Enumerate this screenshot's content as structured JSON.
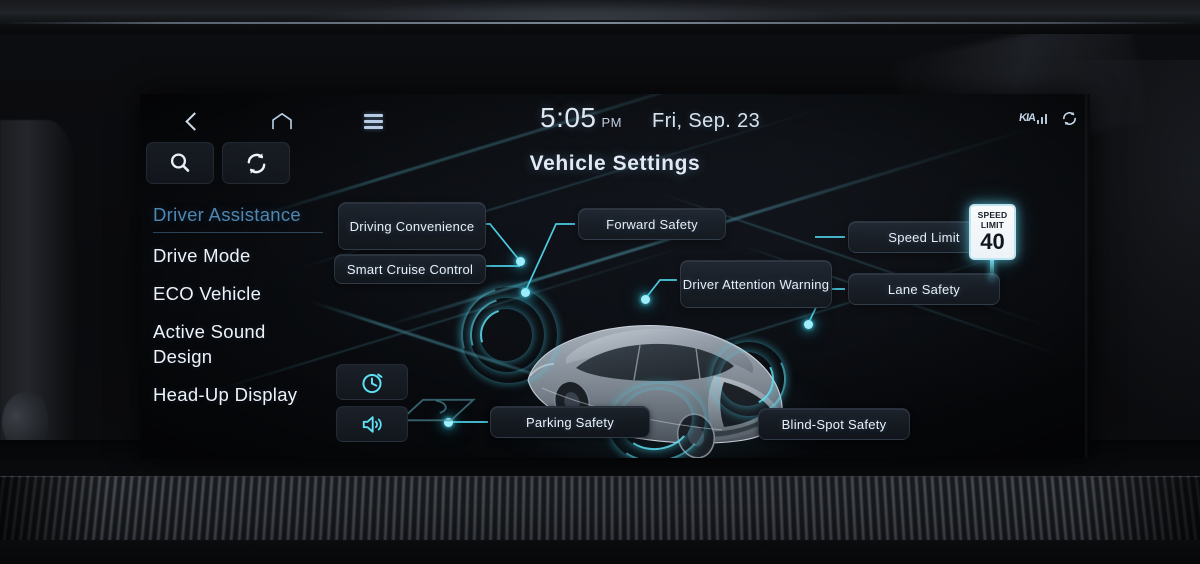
{
  "screen": {
    "title": "Vehicle Settings"
  },
  "topbar": {
    "back_icon": "chevron-left-icon",
    "home_icon": "home-icon",
    "menu_icon": "hamburger-menu-icon",
    "time": "5:05",
    "ampm": "PM",
    "date": "Fri, Sep. 23",
    "brand_mark": "KIA",
    "signal_icon": "signal-bars-icon",
    "sync_icon": "sync-icon"
  },
  "sidebar": {
    "search_icon": "search-icon",
    "refresh_icon": "refresh-sync-icon",
    "items": [
      {
        "label": "Driver Assistance",
        "active": true
      },
      {
        "label": "Drive Mode",
        "active": false
      },
      {
        "label": "ECO Vehicle",
        "active": false
      },
      {
        "label": "Active Sound Design",
        "active": false
      },
      {
        "label": "Head-Up Display",
        "active": false
      }
    ]
  },
  "diagram": {
    "features": [
      {
        "label": "Driving Convenience"
      },
      {
        "label": "Smart Cruise Control"
      },
      {
        "label": "Forward Safety"
      },
      {
        "label": "Driver Attention Warning"
      },
      {
        "label": "Speed Limit"
      },
      {
        "label": "Lane Safety"
      },
      {
        "label": "Parking Safety"
      },
      {
        "label": "Blind-Spot Safety"
      }
    ],
    "speed_sign": {
      "line1": "SPEED",
      "line2": "LIMIT",
      "value": "40"
    },
    "quick_buttons": [
      {
        "icon": "timer-clock-icon"
      },
      {
        "icon": "speaker-volume-icon"
      }
    ]
  },
  "colors": {
    "accent_cyan": "#5fe1f5",
    "active_blue": "#4d87b4",
    "text_primary": "#edf3fa",
    "panel_bg": "#0b0e13"
  }
}
